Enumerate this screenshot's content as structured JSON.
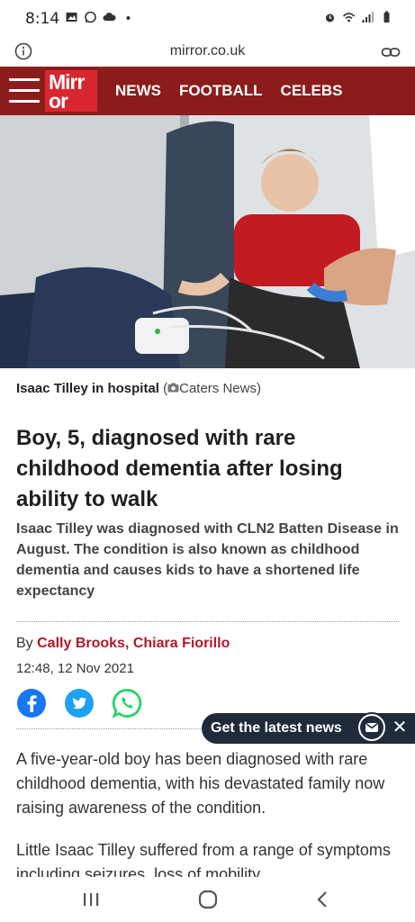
{
  "status_bar": {
    "time": "8:14"
  },
  "browser": {
    "url": "mirror.co.uk"
  },
  "site": {
    "logo_text": "Mirror",
    "nav": [
      "NEWS",
      "FOOTBALL",
      "CELEBS"
    ],
    "brand_color": "#8c1c1c",
    "accent_color": "#d8262e"
  },
  "article": {
    "caption_title": "Isaac Tilley in hospital",
    "caption_credit": "Caters News",
    "headline": "Boy, 5, diagnosed with rare childhood dementia after losing ability to walk",
    "summary": "Isaac Tilley was diagnosed with CLN2 Batten Disease in August. The condition is also known as childhood dementia and causes kids to have a shortened life expectancy",
    "by_label": "By",
    "authors": "Cally Brooks, Chiara Fiorillo",
    "date": "12:48, 12 Nov 2021",
    "share": [
      "facebook-icon",
      "twitter-icon",
      "whatsapp-icon"
    ],
    "paragraphs": [
      "A five-year-old boy has been diagnosed with rare childhood dementia, with his devastated family now raising awareness of the condition.",
      "Little Isaac Tilley suffered from a range of symptoms including seizures, loss of mobility"
    ]
  },
  "newsletter": {
    "label": "Get the latest news"
  },
  "android_nav": [
    "recents-icon",
    "home-icon",
    "back-icon"
  ]
}
